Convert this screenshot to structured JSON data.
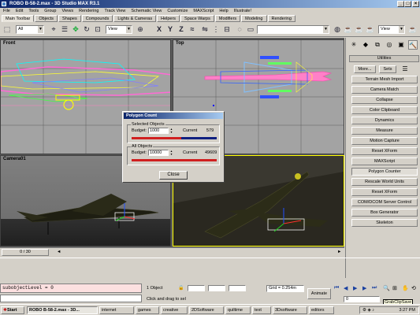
{
  "window": {
    "title": "ROBO B-58-2.max - 3D Studio MAX R3.1"
  },
  "menu": [
    "File",
    "Edit",
    "Tools",
    "Group",
    "Views",
    "Rendering",
    "Track View",
    "Schematic View",
    "Customize",
    "MAXScript",
    "Help",
    "Illustrate!"
  ],
  "tabs": [
    "Main Toolbar",
    "Objects",
    "Shapes",
    "Compounds",
    "Lights & Cameras",
    "Helpers",
    "Space Warps",
    "Modifiers",
    "Modeling",
    "Rendering"
  ],
  "toolbar": {
    "filter_value": "All",
    "refcoord_value": "View",
    "view_value": "View"
  },
  "viewports": {
    "front": "Front",
    "top": "Top",
    "camera": "Camera01",
    "persp": ""
  },
  "command_panel": {
    "rollout_title": "Utilities",
    "more_label": "More...",
    "sets_label": "Sets",
    "utilities": [
      "Terrain Mesh Import",
      "Camera Match",
      "Collapse",
      "Color Clipboard",
      "Dynamics",
      "Measure",
      "Motion Capture",
      "Reset XForm",
      "MAXScript",
      "Polygon Counter",
      "Rescale World Units",
      "Reset XForm",
      "COM/DCOM Server Control",
      "Box Generator",
      "Skeleton"
    ],
    "selected_utility": "Polygon Counter"
  },
  "dialog": {
    "title": "Polygon Count",
    "selected": {
      "group_label": "Selected Objects",
      "budget_label": "Budget:",
      "budget_value": "1000",
      "current_label": "Current",
      "current_value": "579",
      "fraction": 0.58
    },
    "all": {
      "group_label": "All Objects",
      "budget_label": "Budget:",
      "budget_value": "10000",
      "current_label": "Current",
      "current_value": "49609",
      "fraction": 1.0
    },
    "close_label": "Close"
  },
  "timeslider": {
    "frame_label": "0 / 30"
  },
  "status": {
    "listener_text": "subobjectLevel = 0",
    "selection_text": "1 Object",
    "prompt_text": "Click and drag to sel",
    "grid_text": "Grid = 0.254m",
    "animate_label": "Animate",
    "frame_value": "0",
    "tooltip": "GrabClipSave"
  },
  "taskbar": {
    "start_label": "Start",
    "tasks": [
      "ROBO B-58-2.max - 3D...",
      "internet",
      "games",
      "creative",
      "2DSoftware",
      "quiltime",
      "text",
      "3Dsoftware",
      "editors"
    ],
    "active_task": "ROBO B-58-2.max - 3D...",
    "clock": "3:27 PM"
  },
  "colors": {
    "title_gradient_start": "#0a246a",
    "title_gradient_end": "#a6caf0",
    "viewport_gray": "#a0a0a0",
    "active_border": "#ffff00"
  }
}
